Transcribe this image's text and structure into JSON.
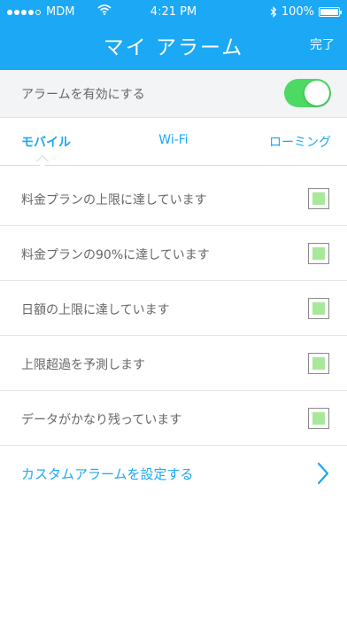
{
  "status_bar": {
    "carrier": "MDM",
    "time": "4:21 PM",
    "battery": "100%"
  },
  "header": {
    "title": "マイ アラーム",
    "done": "完了"
  },
  "enable": {
    "label": "アラームを有効にする",
    "on": true
  },
  "tabs": [
    {
      "label": "モバイル",
      "active": true
    },
    {
      "label": "Wi-Fi",
      "active": false
    },
    {
      "label": "ローミング",
      "active": false
    }
  ],
  "alarms": [
    {
      "label": "料金プランの上限に達しています",
      "checked": true
    },
    {
      "label": "料金プランの90%に達しています",
      "checked": true
    },
    {
      "label": "日額の上限に達しています",
      "checked": true
    },
    {
      "label": "上限超過を予測します",
      "checked": true
    },
    {
      "label": "データがかなり残っています",
      "checked": true
    }
  ],
  "custom": {
    "label": "カスタムアラームを設定する"
  },
  "colors": {
    "accent": "#1ba8f5",
    "toggle_on": "#4cd964",
    "check_fill": "#a8e89a"
  }
}
